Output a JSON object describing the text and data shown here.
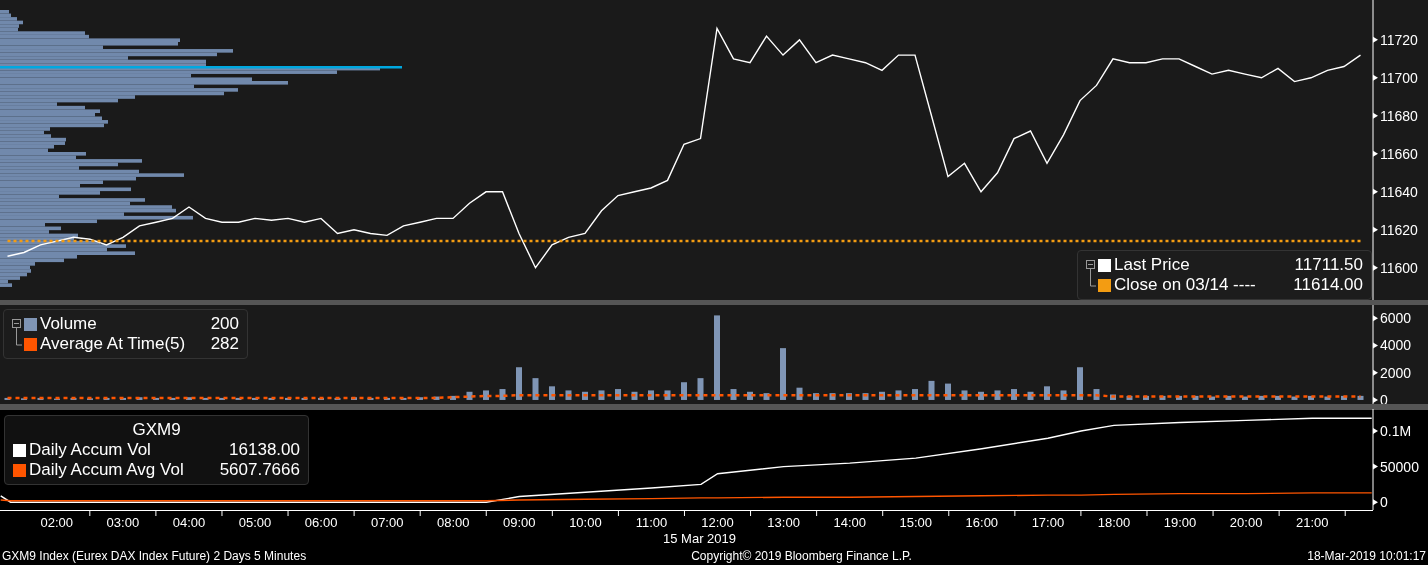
{
  "price_panel": {
    "legend": [
      {
        "value": "11711.50"
      },
      {
        "value": "11614.00"
      }
    ],
    "chart_data": {
      "type": "line",
      "series": [
        {
          "name": "Last Price",
          "color": "#ffffff",
          "values": [
            11606,
            11608,
            11612,
            11614,
            11616,
            11615,
            11612,
            11616,
            11622,
            11624,
            11626,
            11632,
            11626,
            11624,
            11624,
            11626,
            11625,
            11626,
            11624,
            11626,
            11618,
            11620,
            11618,
            11617,
            11622,
            11624,
            11626,
            11626,
            11634,
            11640,
            11640,
            11618,
            11600,
            11612,
            11616,
            11618,
            11630,
            11638,
            11640,
            11642,
            11646,
            11665,
            11668,
            11726,
            11710,
            11708,
            11722,
            11712,
            11720,
            11708,
            11712,
            11710,
            11708,
            11704,
            11712,
            11712,
            11680,
            11648,
            11655,
            11640,
            11650,
            11668,
            11672,
            11655,
            11670,
            11688,
            11696,
            11710,
            11708,
            11708,
            11710,
            11710,
            11706,
            11702,
            11704,
            11702,
            11700,
            11705,
            11698,
            11700,
            11704,
            11706,
            11712
          ]
        },
        {
          "name": "Close on 03/14 ----",
          "color": "#f39c12",
          "line_style": "dotted",
          "values": [
            11614,
            11614,
            11614,
            11614,
            11614,
            11614,
            11614,
            11614,
            11614,
            11614,
            11614,
            11614,
            11614,
            11614,
            11614,
            11614,
            11614,
            11614,
            11614,
            11614,
            11614,
            11614,
            11614,
            11614,
            11614,
            11614,
            11614,
            11614,
            11614,
            11614,
            11614,
            11614,
            11614,
            11614,
            11614,
            11614,
            11614,
            11614,
            11614,
            11614,
            11614,
            11614,
            11614,
            11614,
            11614,
            11614,
            11614,
            11614,
            11614,
            11614,
            11614,
            11614,
            11614,
            11614,
            11614,
            11614,
            11614,
            11614,
            11614,
            11614,
            11614,
            11614,
            11614,
            11614,
            11614,
            11614,
            11614,
            11614,
            11614,
            11614,
            11614,
            11614,
            11614,
            11614,
            11614,
            11614,
            11614,
            11614,
            11614,
            11614,
            11614,
            11614,
            11614
          ]
        }
      ],
      "ylim": [
        11583,
        11741
      ],
      "yticks": [
        11600,
        11620,
        11640,
        11660,
        11680,
        11700,
        11720
      ]
    }
  },
  "volume_panel": {
    "legend": [
      {
        "value": "200"
      },
      {
        "value": "282"
      }
    ],
    "chart_data": {
      "type": "bar",
      "series": [
        {
          "name": "Volume",
          "color": "#7f95b5",
          "values": [
            150,
            120,
            150,
            100,
            150,
            120,
            150,
            150,
            200,
            150,
            150,
            200,
            150,
            150,
            150,
            150,
            150,
            150,
            150,
            150,
            150,
            200,
            150,
            150,
            150,
            200,
            250,
            300,
            600,
            700,
            800,
            2400,
            1600,
            1000,
            700,
            600,
            700,
            800,
            600,
            700,
            700,
            1300,
            1600,
            6200,
            800,
            600,
            500,
            3800,
            900,
            500,
            500,
            500,
            500,
            600,
            700,
            800,
            1400,
            1200,
            700,
            600,
            700,
            800,
            600,
            1000,
            700,
            2400,
            800,
            400,
            300,
            300,
            300,
            300,
            300,
            250,
            300,
            250,
            300,
            300,
            250,
            300,
            250,
            300,
            300
          ]
        },
        {
          "name": "Average At Time(5)",
          "color": "#ff5500",
          "type": "line",
          "line_style": "dashed",
          "values": [
            150,
            150,
            150,
            150,
            150,
            150,
            150,
            150,
            150,
            150,
            150,
            150,
            150,
            150,
            150,
            150,
            150,
            150,
            150,
            150,
            150,
            150,
            150,
            150,
            150,
            150,
            150,
            200,
            250,
            300,
            300,
            350,
            350,
            350,
            350,
            350,
            350,
            350,
            350,
            350,
            350,
            350,
            350,
            350,
            350,
            350,
            350,
            350,
            350,
            350,
            350,
            350,
            350,
            350,
            350,
            350,
            350,
            350,
            350,
            350,
            350,
            350,
            350,
            350,
            350,
            350,
            350,
            250,
            250,
            250,
            250,
            250,
            250,
            250,
            250,
            250,
            250,
            250,
            250,
            250,
            250,
            250,
            250
          ]
        }
      ],
      "ylim": [
        -296,
        6963
      ],
      "yticks": [
        0,
        2000,
        4000,
        6000
      ]
    }
  },
  "accum_panel": {
    "title": "GXM9",
    "legend": [
      {
        "value": "16138.00"
      },
      {
        "value": "5607.7666"
      }
    ],
    "chart_data": {
      "type": "line",
      "x": [
        1.15,
        1.3,
        8.5,
        9,
        10,
        11,
        11.75,
        12,
        13,
        14,
        15,
        16,
        17,
        17.5,
        18,
        19,
        20,
        21,
        21.9
      ],
      "series": [
        {
          "name": "Daily Accum Vol",
          "color": "#ffffff",
          "values": [
            9000,
            0,
            0,
            8000,
            14000,
            20000,
            25000,
            40000,
            50000,
            55000,
            62000,
            75000,
            90000,
            100000,
            108000,
            112000,
            115000,
            118000,
            118000
          ]
        },
        {
          "name": "Daily Accum Avg Vol",
          "color": "#ff5500",
          "values": [
            3000,
            2000,
            2000,
            3000,
            4000,
            5000,
            6000,
            6000,
            7000,
            7000,
            8000,
            9000,
            10000,
            10000,
            11000,
            12000,
            12000,
            13000,
            13000
          ]
        }
      ],
      "ylim": [
        -11000,
        131000
      ],
      "xlim": [
        1.14,
        21.92
      ],
      "yticks": [
        {
          "value": 0,
          "label": "0"
        },
        {
          "value": 50000,
          "label": "50000"
        },
        {
          "value": 100000,
          "label": "0.1M"
        }
      ],
      "xticks": [
        {
          "value": 2,
          "label": "02:00"
        },
        {
          "value": 3,
          "label": "03:00"
        },
        {
          "value": 4,
          "label": "04:00"
        },
        {
          "value": 5,
          "label": "05:00"
        },
        {
          "value": 6,
          "label": "06:00"
        },
        {
          "value": 7,
          "label": "07:00"
        },
        {
          "value": 8,
          "label": "08:00"
        },
        {
          "value": 9,
          "label": "09:00"
        },
        {
          "value": 10,
          "label": "10:00"
        },
        {
          "value": 11,
          "label": "11:00"
        },
        {
          "value": 12,
          "label": "12:00"
        },
        {
          "value": 13,
          "label": "13:00"
        },
        {
          "value": 14,
          "label": "14:00"
        },
        {
          "value": 15,
          "label": "15:00"
        },
        {
          "value": 16,
          "label": "16:00"
        },
        {
          "value": 17,
          "label": "17:00"
        },
        {
          "value": 18,
          "label": "18:00"
        },
        {
          "value": 19,
          "label": "19:00"
        },
        {
          "value": 20,
          "label": "20:00"
        },
        {
          "value": 21,
          "label": "21:00"
        }
      ]
    }
  },
  "time_axis": {
    "date": "15 Mar 2019"
  },
  "footer": {
    "left": "GXM9 Index (Eurex DAX Index Future) 2 Days 5 Minutes",
    "center": "Copyright© 2019 Bloomberg Finance L.P.",
    "right": "18-Mar-2019 10:01:17"
  }
}
